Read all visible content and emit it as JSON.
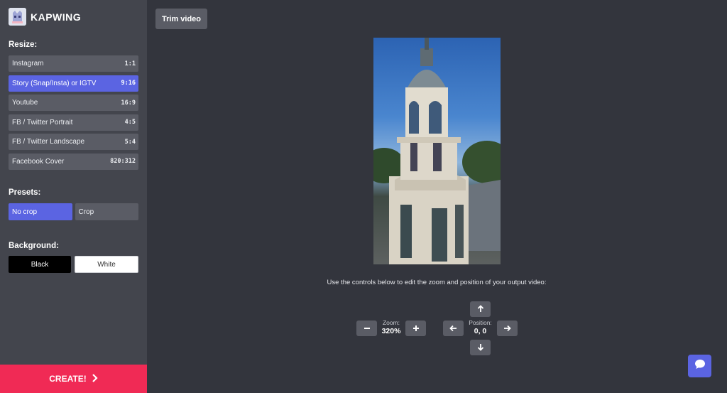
{
  "brand": {
    "name": "KAPWING"
  },
  "sidebar": {
    "resize_label": "Resize:",
    "resize_options": [
      {
        "label": "Instagram",
        "ratio": "1:1",
        "active": false
      },
      {
        "label": "Story (Snap/Insta) or IGTV",
        "ratio": "9:16",
        "active": true
      },
      {
        "label": "Youtube",
        "ratio": "16:9",
        "active": false
      },
      {
        "label": "FB / Twitter Portrait",
        "ratio": "4:5",
        "active": false
      },
      {
        "label": "FB / Twitter Landscape",
        "ratio": "5:4",
        "active": false
      },
      {
        "label": "Facebook Cover",
        "ratio": "820:312",
        "active": false
      }
    ],
    "presets_label": "Presets:",
    "presets": [
      {
        "label": "No crop",
        "active": true
      },
      {
        "label": "Crop",
        "active": false
      }
    ],
    "background_label": "Background:",
    "background_options": [
      {
        "label": "Black"
      },
      {
        "label": "White"
      }
    ],
    "create_label": "CREATE!"
  },
  "main": {
    "trim_label": "Trim video",
    "instructions": "Use the controls below to edit the zoom and position of your output video:",
    "zoom_label": "Zoom:",
    "zoom_value": "320%",
    "position_label": "Position:",
    "position_value": "0, 0"
  },
  "colors": {
    "accent": "#5b64e2",
    "create": "#f02a55",
    "sidebar_bg": "#43454d",
    "main_bg": "#33353d"
  },
  "icons": {
    "logo": "kapwing-logo-icon",
    "create": "chevron-right-icon",
    "zoom_out": "minus-icon",
    "zoom_in": "plus-icon",
    "up": "arrow-up-icon",
    "down": "arrow-down-icon",
    "left": "arrow-left-icon",
    "right": "arrow-right-icon",
    "chat": "chat-bubble-icon"
  }
}
